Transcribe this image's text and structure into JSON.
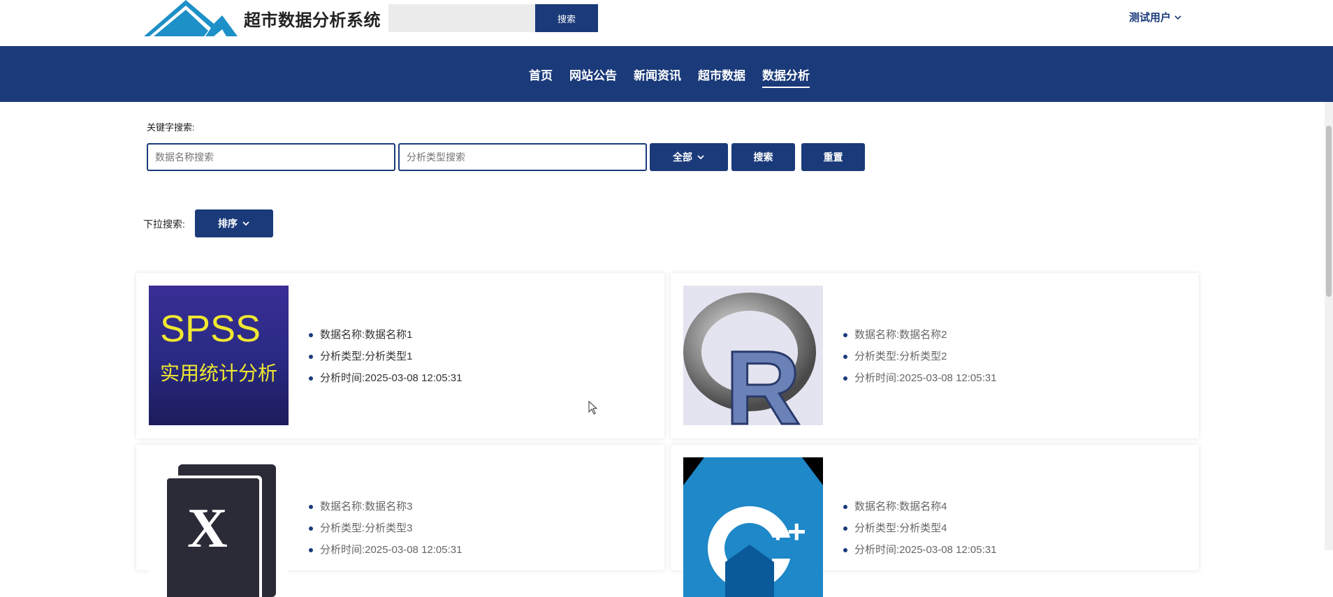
{
  "header": {
    "site_title": "超市数据分析系统",
    "search_placeholder": "",
    "search_button": "搜索",
    "user_label": "测试用户"
  },
  "nav": {
    "items": [
      {
        "label": "首页",
        "active": false
      },
      {
        "label": "网站公告",
        "active": false
      },
      {
        "label": "新闻资讯",
        "active": false
      },
      {
        "label": "超市数据",
        "active": false
      },
      {
        "label": "数据分析",
        "active": true
      }
    ]
  },
  "filters": {
    "keyword_label": "关键字搜索:",
    "name_placeholder": "数据名称搜索",
    "type_placeholder": "分析类型搜索",
    "all_button": "全部",
    "search_button": "搜索",
    "reset_button": "重置",
    "dropdown_label": "下拉搜索:",
    "sort_button": "排序"
  },
  "cards": [
    {
      "image_text_line1": "SPSS",
      "image_text_line2": "实用统计分析",
      "name": "数据名称:数据名称1",
      "type": "分析类型:分析类型1",
      "time": "分析时间:2025-03-08 12:05:31"
    },
    {
      "image_letter": "R",
      "name": "数据名称:数据名称2",
      "type": "分析类型:分析类型2",
      "time": "分析时间:2025-03-08 12:05:31"
    },
    {
      "image_letter": "X",
      "name": "数据名称:数据名称3",
      "type": "分析类型:分析类型3",
      "time": "分析时间:2025-03-08 12:05:31"
    },
    {
      "image_text": "++",
      "name": "数据名称:数据名称4",
      "type": "分析类型:分析类型4",
      "time": "分析时间:2025-03-08 12:05:31"
    }
  ],
  "colors": {
    "primary": "#1a3a7a",
    "logo_blue": "#1e90c8",
    "spss_bg": "#2a2a85",
    "spss_text": "#f0e830",
    "cpp_blue": "#1e88c8"
  }
}
